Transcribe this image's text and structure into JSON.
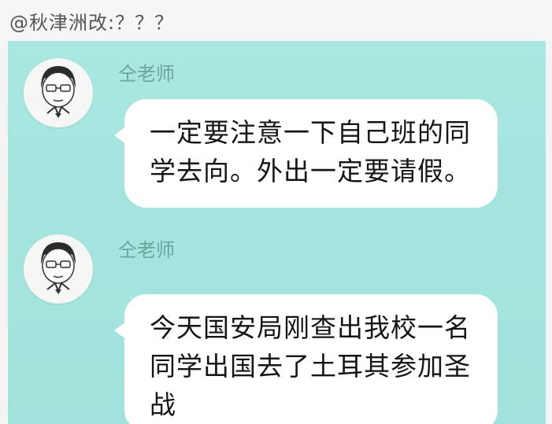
{
  "header": {
    "text": "@秋津洲改:？？？"
  },
  "messages": [
    {
      "sender": "仝老师",
      "text": "一定要注意一下自己班的同学去向。外出一定要请假。"
    },
    {
      "sender": "仝老师",
      "text": "今天国安局刚查出我校一名同学出国去了土耳其参加圣战"
    }
  ],
  "colors": {
    "chat_background": "#a6e5df",
    "sender_name": "#6aa6a0",
    "bubble": "#ffffff"
  }
}
